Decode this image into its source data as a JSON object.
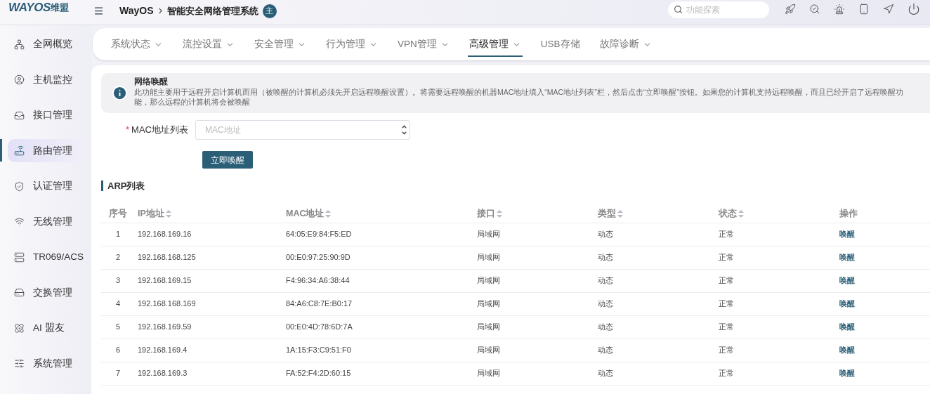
{
  "header": {
    "logo": "WAYOS",
    "logo_cn": "维盟",
    "breadcrumb": [
      "WayOS",
      "智能安全网络管理系统"
    ],
    "badge": "主",
    "search": {
      "placeholder": "功能探索"
    }
  },
  "sidebar": {
    "items": [
      {
        "label": "全网概览",
        "selected": false
      },
      {
        "label": "主机监控",
        "selected": false
      },
      {
        "label": "接口管理",
        "selected": false
      },
      {
        "label": "路由管理",
        "selected": true
      },
      {
        "label": "认证管理",
        "selected": false
      },
      {
        "label": "无线管理",
        "selected": false
      },
      {
        "label": "TR069/ACS",
        "selected": false
      },
      {
        "label": "交换管理",
        "selected": false
      },
      {
        "label": "AI 盟友",
        "selected": false
      },
      {
        "label": "系统管理",
        "selected": false
      }
    ]
  },
  "tabs": [
    {
      "label": "系统状态",
      "dropdown": true,
      "selected": false
    },
    {
      "label": "流控设置",
      "dropdown": true,
      "selected": false
    },
    {
      "label": "安全管理",
      "dropdown": true,
      "selected": false
    },
    {
      "label": "行为管理",
      "dropdown": true,
      "selected": false
    },
    {
      "label": "VPN管理",
      "dropdown": true,
      "selected": false
    },
    {
      "label": "高级管理",
      "dropdown": true,
      "selected": true
    },
    {
      "label": "USB存储",
      "dropdown": false,
      "selected": false
    },
    {
      "label": "故障诊断",
      "dropdown": true,
      "selected": false
    }
  ],
  "info": {
    "title": "网络唤醒",
    "text": "此功能主要用于远程开启计算机而用（被唤醒的计算机必须先开启远程唤醒设置）。将需要远程唤醒的机器MAC地址填入“MAC地址列表”栏，然后点击“立即唤醒”按钮。如果您的计算机支持远程唤醒，而且已经开启了远程唤醒功能，那么远程的计算机将会被唤醒"
  },
  "form": {
    "required_mark": "*",
    "label": "MAC地址列表",
    "placeholder": "MAC地址",
    "button": "立即唤醒"
  },
  "arp": {
    "title": "ARP列表",
    "columns": [
      {
        "label": "序号",
        "sortable": false
      },
      {
        "label": "IP地址",
        "sortable": true
      },
      {
        "label": "MAC地址",
        "sortable": true
      },
      {
        "label": "接口",
        "sortable": true
      },
      {
        "label": "类型",
        "sortable": true
      },
      {
        "label": "状态",
        "sortable": true
      },
      {
        "label": "操作",
        "sortable": false
      }
    ],
    "rows": [
      [
        "1",
        "192.168.169.16",
        "64:05:E9:84:F5:ED",
        "局域网",
        "动态",
        "正常",
        "唤醒"
      ],
      [
        "2",
        "192.168.168.125",
        "00:E0:97:25:90:9D",
        "局域网",
        "动态",
        "正常",
        "唤醒"
      ],
      [
        "3",
        "192.168.169.15",
        "F4:96:34:A6:38:44",
        "局域网",
        "动态",
        "正常",
        "唤醒"
      ],
      [
        "4",
        "192.168.168.169",
        "84:A6:C8:7E:B0:17",
        "局域网",
        "动态",
        "正常",
        "唤醒"
      ],
      [
        "5",
        "192.168.169.59",
        "00:E0:4D:78:6D:7A",
        "局域网",
        "动态",
        "正常",
        "唤醒"
      ],
      [
        "6",
        "192.168.169.4",
        "1A:15:F3:C9:51:F0",
        "局域网",
        "动态",
        "正常",
        "唤醒"
      ],
      [
        "7",
        "192.168.169.3",
        "FA:52:F4:2D:60:15",
        "局域网",
        "动态",
        "正常",
        "唤醒"
      ]
    ]
  }
}
